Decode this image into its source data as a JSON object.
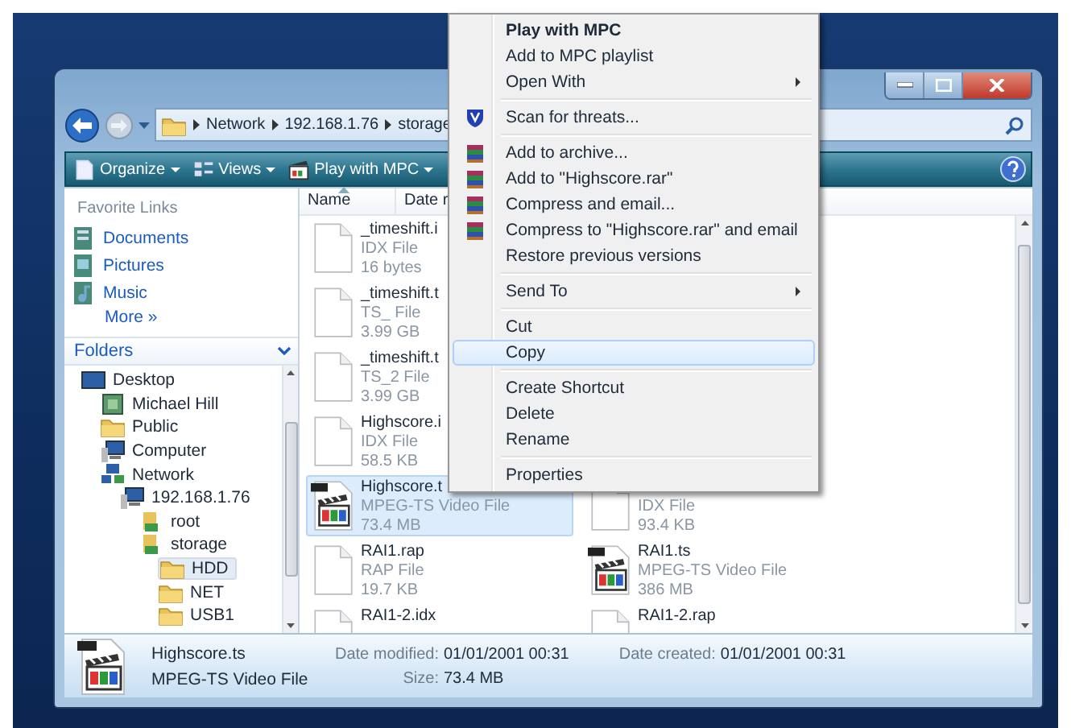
{
  "address_bar": {
    "crumbs": [
      "Network",
      "192.168.1.76",
      "storage"
    ]
  },
  "toolbar": [
    {
      "label": "Organize"
    },
    {
      "label": "Views"
    },
    {
      "label": "Play with MPC"
    }
  ],
  "favorite_links": {
    "title": "Favorite Links",
    "items": [
      {
        "label": "Documents",
        "kind": "documents"
      },
      {
        "label": "Pictures",
        "kind": "pictures"
      },
      {
        "label": "Music",
        "kind": "music"
      }
    ],
    "more": "More »"
  },
  "folders": {
    "title": "Folders",
    "tree": [
      {
        "label": "Desktop",
        "kind": "desktop",
        "selected": false,
        "children": [
          {
            "label": "Michael Hill",
            "kind": "user",
            "selected": false
          },
          {
            "label": "Public",
            "kind": "folder",
            "selected": false
          },
          {
            "label": "Computer",
            "kind": "computer",
            "selected": false
          },
          {
            "label": "Network",
            "kind": "network",
            "selected": false,
            "children": [
              {
                "label": "192.168.1.76",
                "kind": "computer",
                "selected": false,
                "children": [
                  {
                    "label": "root",
                    "kind": "share",
                    "selected": false
                  },
                  {
                    "label": "storage",
                    "kind": "share",
                    "selected": false,
                    "children": [
                      {
                        "label": "HDD",
                        "kind": "folder",
                        "selected": true
                      },
                      {
                        "label": "NET",
                        "kind": "folder",
                        "selected": false
                      },
                      {
                        "label": "USB1",
                        "kind": "folder",
                        "selected": false
                      }
                    ]
                  }
                ]
              }
            ]
          }
        ]
      }
    ]
  },
  "file_list": {
    "columns": [
      "Name",
      "Date r"
    ],
    "file_columns": [
      [
        {
          "name": "_timeshift.i",
          "type": "IDX File",
          "size": "16 bytes",
          "kind": "file",
          "selected": false
        },
        {
          "name": "_timeshift.t",
          "type": "TS_ File",
          "size": "3.99 GB",
          "kind": "file",
          "selected": false
        },
        {
          "name": "_timeshift.t",
          "type": "TS_2 File",
          "size": "3.99 GB",
          "kind": "file",
          "selected": false
        },
        {
          "name": "Highscore.i",
          "type": "IDX File",
          "size": "58.5 KB",
          "kind": "file",
          "selected": false
        },
        {
          "name": "Highscore.t",
          "type": "MPEG-TS Video File",
          "size": "73.4 MB",
          "kind": "video",
          "selected": true
        },
        {
          "name": "RAI1.rap",
          "type": "RAP File",
          "size": "19.7 KB",
          "kind": "file",
          "selected": false
        },
        {
          "name": "RAI1-2.idx",
          "kind": "file",
          "selected": false
        }
      ],
      [
        {
          "type": "IDX File",
          "size": "93.4 KB",
          "kind": "file",
          "selected": false
        },
        {
          "name": "RAI1.ts",
          "type": "MPEG-TS Video File",
          "size": "386 MB",
          "kind": "video",
          "selected": false
        },
        {
          "name": "RAI1-2.rap",
          "kind": "file",
          "selected": false
        }
      ]
    ]
  },
  "details": {
    "name": "Highscore.ts",
    "type": "MPEG-TS Video File",
    "fields": [
      {
        "label": "Date modified:",
        "value": "01/01/2001 00:31"
      },
      {
        "label": "Size:",
        "value": "73.4 MB"
      },
      {
        "label": "Date created:",
        "value": "01/01/2001 00:31"
      }
    ]
  },
  "context_menu": {
    "items": [
      {
        "kind": "item",
        "label": "Play with MPC",
        "bold": true,
        "submenu": false,
        "selected": false
      },
      {
        "kind": "item",
        "label": "Add to MPC playlist",
        "bold": false,
        "submenu": false,
        "selected": false
      },
      {
        "kind": "item",
        "label": "Open With",
        "bold": false,
        "submenu": true,
        "selected": false
      },
      {
        "kind": "separator"
      },
      {
        "kind": "scan",
        "label": "Scan for threats...",
        "bold": false,
        "submenu": false,
        "selected": false
      },
      {
        "kind": "separator"
      },
      {
        "kind": "archive",
        "label": "Add to archive...",
        "bold": false,
        "submenu": false,
        "selected": false
      },
      {
        "kind": "archive",
        "label": "Add to \"Highscore.rar\"",
        "bold": false,
        "submenu": false,
        "selected": false
      },
      {
        "kind": "archive",
        "label": "Compress and email...",
        "bold": false,
        "submenu": false,
        "selected": false
      },
      {
        "kind": "archive",
        "label": "Compress to \"Highscore.rar\" and email",
        "bold": false,
        "submenu": false,
        "selected": false
      },
      {
        "kind": "item",
        "label": "Restore previous versions",
        "bold": false,
        "submenu": false,
        "selected": false
      },
      {
        "kind": "separator"
      },
      {
        "kind": "item",
        "label": "Send To",
        "bold": false,
        "submenu": true,
        "selected": false
      },
      {
        "kind": "separator"
      },
      {
        "kind": "item",
        "label": "Cut",
        "bold": false,
        "submenu": false,
        "selected": false
      },
      {
        "kind": "item",
        "label": "Copy",
        "bold": false,
        "submenu": false,
        "selected": true
      },
      {
        "kind": "separator"
      },
      {
        "kind": "item",
        "label": "Create Shortcut",
        "bold": false,
        "submenu": false,
        "selected": false
      },
      {
        "kind": "item",
        "label": "Delete",
        "bold": false,
        "submenu": false,
        "selected": false
      },
      {
        "kind": "item",
        "label": "Rename",
        "bold": false,
        "submenu": false,
        "selected": false
      },
      {
        "kind": "separator"
      },
      {
        "kind": "item",
        "label": "Properties",
        "bold": false,
        "submenu": false,
        "selected": false
      }
    ]
  }
}
